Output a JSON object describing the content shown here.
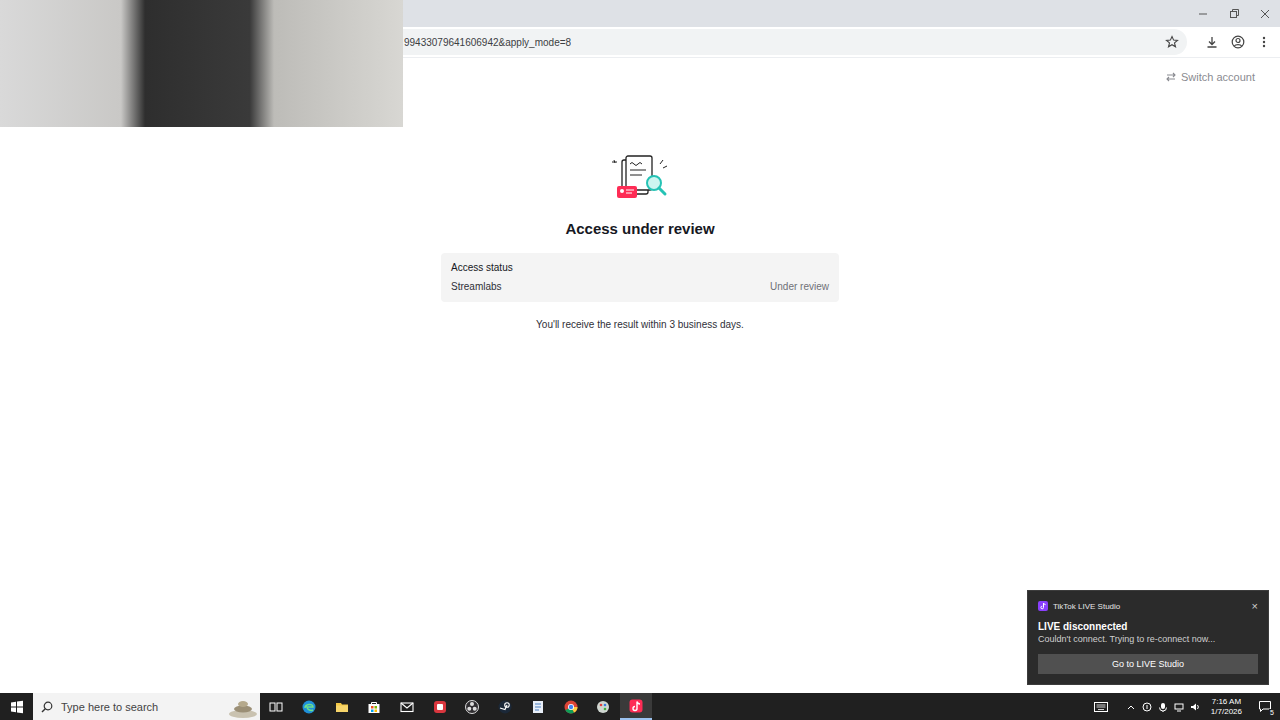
{
  "browser": {
    "url": "99433079641606942&apply_mode=8"
  },
  "page": {
    "switch_account": "Switch account",
    "title": "Access under review",
    "status_card": {
      "heading": "Access status",
      "rows": [
        {
          "name": "Streamlabs",
          "status": "Under review"
        }
      ]
    },
    "note": "You'll receive the result within 3 business days."
  },
  "notification": {
    "app": "TikTok LIVE Studio",
    "close": "×",
    "title": "LIVE disconnected",
    "message": "Couldn't connect. Trying to re-connect now...",
    "button": "Go to LIVE Studio"
  },
  "taskbar": {
    "search_placeholder": "Type here to search",
    "apps": [
      {
        "kind": "taskview",
        "active": false
      },
      {
        "kind": "edge",
        "active": false
      },
      {
        "kind": "explorer",
        "active": false
      },
      {
        "kind": "store",
        "active": false
      },
      {
        "kind": "mail",
        "active": false
      },
      {
        "kind": "redapp",
        "active": false
      },
      {
        "kind": "obs",
        "active": false
      },
      {
        "kind": "steam",
        "active": false
      },
      {
        "kind": "notepad",
        "active": false
      },
      {
        "kind": "chrome",
        "active": false
      },
      {
        "kind": "paint",
        "active": false
      },
      {
        "kind": "tiktok",
        "active": true
      }
    ],
    "clock": {
      "time": "7:16 AM",
      "date": "1/7/2026"
    },
    "notifications_count": "5"
  }
}
